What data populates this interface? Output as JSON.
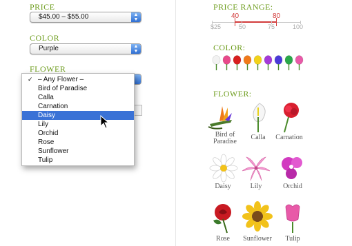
{
  "left": {
    "price": {
      "label": "PRICE",
      "value": "$45.00 – $55.00"
    },
    "color": {
      "label": "COLOR",
      "value": "Purple"
    },
    "flower": {
      "label": "FLOWER"
    },
    "dropdown": {
      "items": [
        {
          "label": "– Any Flower –",
          "checked": true
        },
        {
          "label": "Bird of Paradise"
        },
        {
          "label": "Calla"
        },
        {
          "label": "Carnation"
        },
        {
          "label": "Daisy",
          "highlighted": true
        },
        {
          "label": "Lily"
        },
        {
          "label": "Orchid"
        },
        {
          "label": "Rose"
        },
        {
          "label": "Sunflower"
        },
        {
          "label": "Tulip"
        }
      ],
      "check_mark": "✓"
    }
  },
  "right": {
    "price_range": {
      "label": "PRICE RANGE:",
      "low": "40",
      "high": "80",
      "scale": [
        "$25",
        "50",
        "75",
        "100"
      ]
    },
    "color": {
      "label": "COLOR:",
      "swatches": [
        "#f2f2f2",
        "#e84a8a",
        "#d81f1f",
        "#f07a1a",
        "#f2d21a",
        "#a43ad8",
        "#4a3ad8",
        "#2aa84a",
        "#e85aa8"
      ]
    },
    "flower": {
      "label": "FLOWER:",
      "items": [
        {
          "name_line1": "Bird of",
          "name_line2": "Paradise"
        },
        {
          "name_line1": "Calla"
        },
        {
          "name_line1": "Carnation"
        },
        {
          "name_line1": "Daisy"
        },
        {
          "name_line1": "Lily"
        },
        {
          "name_line1": "Orchid"
        },
        {
          "name_line1": "Rose"
        },
        {
          "name_line1": "Sunflower"
        },
        {
          "name_line1": "Tulip"
        }
      ]
    }
  },
  "icons": {
    "popup_arrows": "chevron-updown-icon",
    "cursor": "arrow-cursor-icon"
  }
}
